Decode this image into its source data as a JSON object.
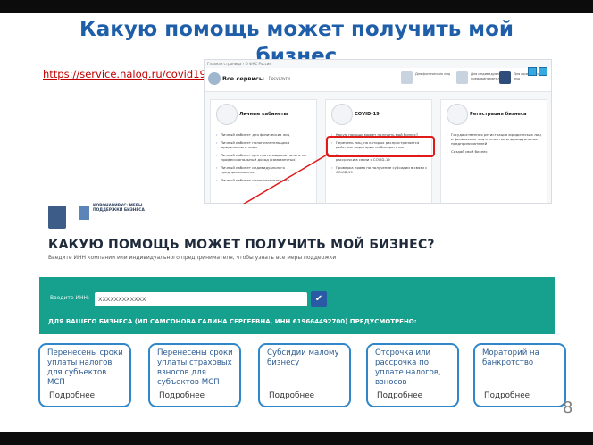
{
  "slide": {
    "title": "Какую помощь может получить мой бизнес",
    "url": "https://service.nalog.ru/covid19/",
    "page_number": "8"
  },
  "site": {
    "breadcrumbs": "Главная страница › О ФНС России",
    "all_services_label": "Все сервисы",
    "gosuslugi_label": "Госуслуги",
    "user_categories": [
      "Для физических лиц",
      "Для индивидуальных предпринимателей",
      "Для юридических лиц"
    ],
    "cards": [
      {
        "title": "Личные кабинеты",
        "links": [
          "Личный кабинет для физических лиц",
          "Личный кабинет налогоплательщика юридического лица",
          "Личный кабинет для плательщиков налога на профессиональный доход (самозанятых)",
          "Личный кабинет индивидуального предпринимателя",
          "Личный кабинет налогоплательщика"
        ]
      },
      {
        "title": "COVID-19",
        "links": [
          "Какую помощь может получить мой бизнес?",
          "Перечень лиц, на которых распространяется действие моратория на банкротство",
          "Проверка возможности получения отсрочки/рассрочки в связи с COVID-19",
          "Проверка права на получение субсидии в связи с COVID-19"
        ]
      },
      {
        "title": "Регистрация бизнеса",
        "links": [
          "Государственная регистрация юридических лиц и физических лиц в качестве индивидуальных предпринимателей",
          "Создай свой бизнес"
        ]
      }
    ]
  },
  "covid_page": {
    "logo_text": "КОРОНАВИРУС: МЕРЫ ПОДДЕРЖКИ БИЗНЕСА",
    "heading": "КАКУЮ ПОМОЩЬ МОЖЕТ ПОЛУЧИТЬ МОЙ БИЗНЕС?",
    "subtitle": "Введите ИНН компании или индивидуального предпринимателя, чтобы узнать все меры поддержки",
    "inn_label": "Введите ИНН:",
    "inn_value": "XXXXXXXXXXXX",
    "submit_icon": "check-icon",
    "result_line": "ДЛЯ ВАШЕГО БИЗНЕСА (ИП САМСОНОВА ГАЛИНА СЕРГЕЕВНА, ИНН 619664492700) ПРЕДУСМОТРЕНО:"
  },
  "measures": [
    {
      "title": "Перенесены сроки уплаты налогов для субъектов МСП",
      "more": "Подробнее"
    },
    {
      "title": "Перенесены сроки уплаты страховых взносов для субъектов МСП",
      "more": "Подробнее"
    },
    {
      "title": "Субсидии малому бизнесу",
      "more": "Подробнее"
    },
    {
      "title": "Отсрочка или рассрочка по уплате налогов, взносов",
      "more": "Подробнее"
    },
    {
      "title": "Мораторий на банкротство",
      "more": "Подробнее"
    }
  ],
  "colors": {
    "title": "#1f5ea8",
    "url": "#c00000",
    "highlight": "#e01919",
    "green_panel": "#15a18e",
    "box_border": "#2f86c9"
  }
}
